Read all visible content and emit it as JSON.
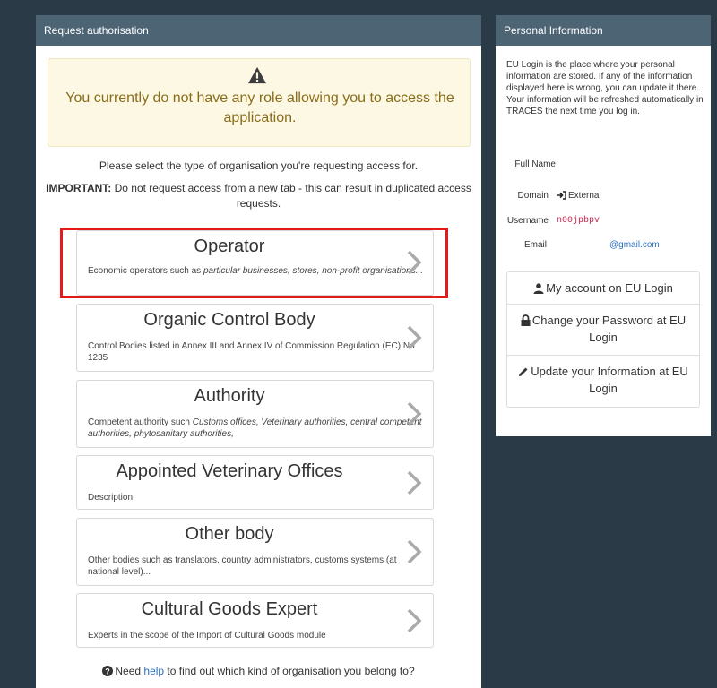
{
  "left_panel": {
    "title": "Request authorisation",
    "warning": "You currently do not have any role allowing you to access the application.",
    "intro": "Please select the type of organisation you're requesting access for.",
    "important_label": "IMPORTANT:",
    "important_text": " Do not request access from a new tab - this can result in duplicated access requests.",
    "cards": [
      {
        "title": "Operator",
        "desc_plain": "Economic operators such as ",
        "desc_italic": "particular businesses, stores, non-profit organisations..."
      },
      {
        "title": "Organic Control Body",
        "desc_plain": "Control Bodies listed in Annex III and Annex IV of Commission Regulation (EC) No 1235",
        "desc_italic": ""
      },
      {
        "title": "Authority",
        "desc_plain": "Competent authority such ",
        "desc_italic": "Customs offices, Veterinary authorities, central competent authorities, phytosanitary authorities,"
      },
      {
        "title": "Appointed Veterinary Offices",
        "desc_plain": "Description",
        "desc_italic": ""
      },
      {
        "title": "Other body",
        "desc_plain": "Other bodies such as translators, country administrators, customs systems (at national level)...",
        "desc_italic": ""
      },
      {
        "title": "Cultural Goods Expert",
        "desc_plain": "Experts in the scope of the Import of Cultural Goods module",
        "desc_italic": ""
      }
    ],
    "help_prefix": "Need ",
    "help_link": "help",
    "help_suffix": " to find out which kind of organisation you belong to?"
  },
  "right_panel": {
    "title": "Personal Information",
    "info": "EU Login is the place where your personal information are stored. If any of the information displayed here is wrong, you can update it there. Your information will be refreshed automatically in TRACES the next time you log in.",
    "fields": {
      "full_name_label": "Full Name",
      "domain_label": "Domain",
      "domain_value": "External",
      "username_label": "Username",
      "username_value": "n00jpbpv",
      "email_label": "Email",
      "email_value": "@gmail.com"
    },
    "buttons": {
      "account": "My account on EU Login",
      "password": "Change your Password at EU Login",
      "update": "Update your Information at EU Login"
    }
  },
  "colors": {
    "background": "#2b3a47",
    "panel_header": "#4d6475",
    "highlight": "#e51b1b",
    "warning_text": "#8a6d1b",
    "link": "#2a70c2"
  }
}
